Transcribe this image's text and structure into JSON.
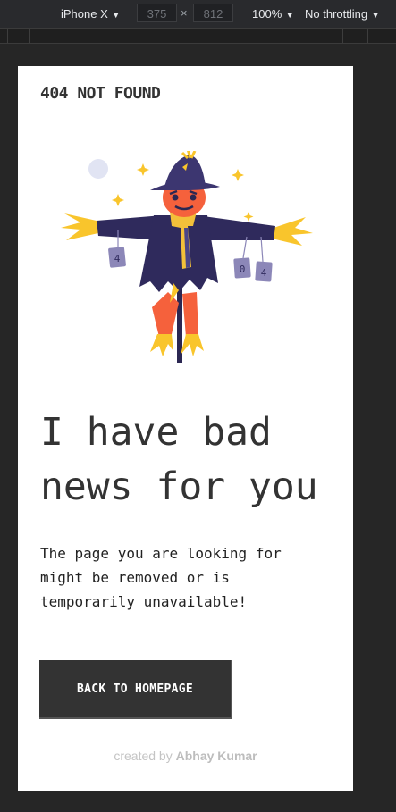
{
  "devtools": {
    "device": "iPhone X",
    "width": "375",
    "height": "812",
    "times": "×",
    "zoom": "100%",
    "throttling": "No throttling"
  },
  "page": {
    "title": "404 NOT FOUND",
    "headline_line1": "I have bad",
    "headline_line2": "news for you",
    "message_line1": "The page you are looking for",
    "message_line2": "might be removed or is",
    "message_line3": "temporarily unavailable!",
    "button_label": "BACK TO HOMEPAGE",
    "footer_prefix": "created by",
    "footer_author": "Abhay Kumar",
    "can_labels": [
      "4",
      "0",
      "4"
    ]
  },
  "colors": {
    "text": "#333333",
    "button_bg": "#333333",
    "scarecrow_coat": "#2f2a5c",
    "scarecrow_hat": "#3c3670",
    "scarecrow_skin": "#f5613c",
    "straw": "#f9c52c",
    "scarf": "#f3c03a"
  }
}
